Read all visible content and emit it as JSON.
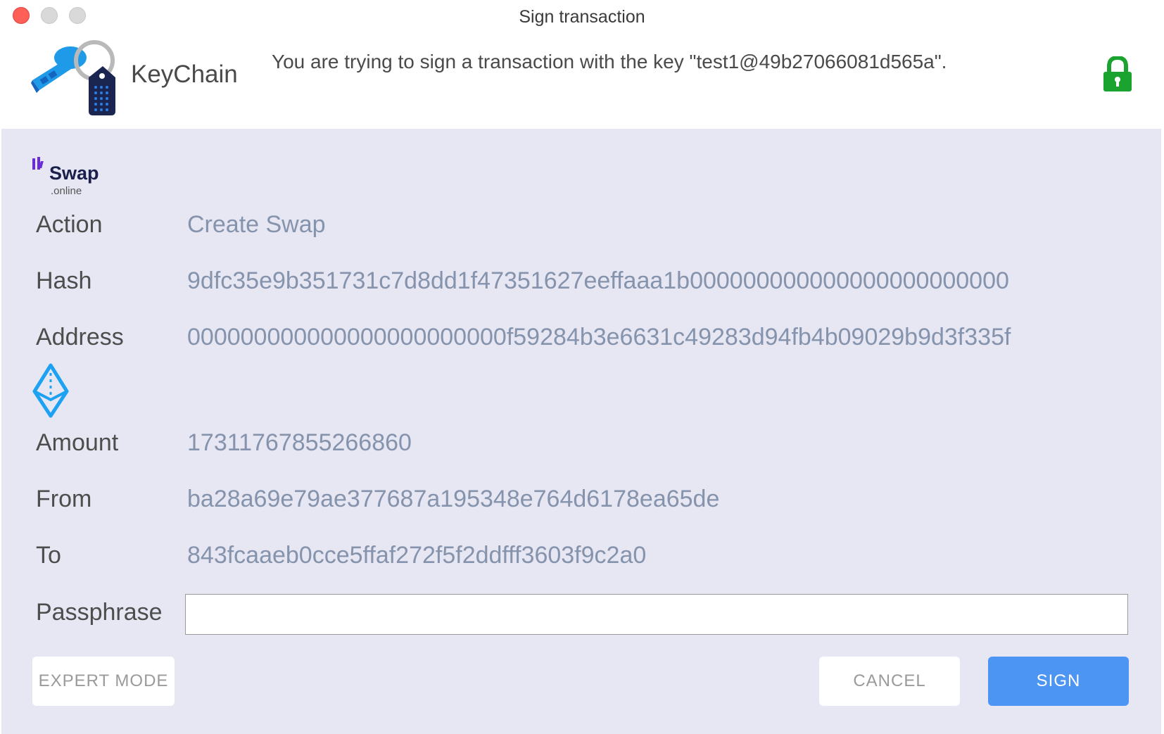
{
  "window": {
    "title": "Sign transaction"
  },
  "header": {
    "app_name": "KeyChain",
    "message": "You are trying to sign a transaction with the key \"test1@49b27066081d565a\".",
    "lock_color": "#1aa32f"
  },
  "dapp": {
    "name": "Swap",
    "domain_suffix": ".online"
  },
  "fields": {
    "action": {
      "label": "Action",
      "value": "Create Swap"
    },
    "hash": {
      "label": "Hash",
      "value": "9dfc35e9b351731c7d8dd1f47351627eeffaaa1b000000000000000000000000"
    },
    "address": {
      "label": "Address",
      "value": "000000000000000000000000f59284b3e6631c49283d94fb4b09029b9d3f335f"
    },
    "amount": {
      "label": "Amount",
      "value": "17311767855266860"
    },
    "from": {
      "label": "From",
      "value": "ba28a69e79ae377687a195348e764d6178ea65de"
    },
    "to": {
      "label": "To",
      "value": "843fcaaeb0cce5ffaf272f5f2ddfff3603f9c2a0"
    }
  },
  "passphrase": {
    "label": "Passphrase",
    "value": "",
    "placeholder": ""
  },
  "buttons": {
    "expert_mode": "EXPERT MODE",
    "cancel": "CANCEL",
    "sign": "SIGN"
  },
  "colors": {
    "panel_bg": "#e6e7f2",
    "value_text": "#8593ac",
    "sign_button": "#4d95f3",
    "eth_icon": "#1da1f2"
  }
}
